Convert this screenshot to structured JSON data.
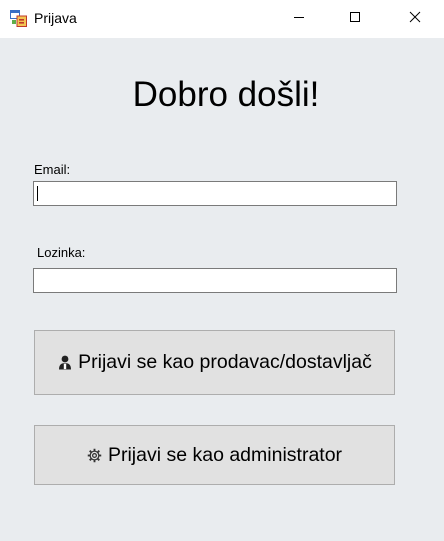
{
  "window": {
    "title": "Prijava",
    "app_icon": "form-icon",
    "controls": [
      "minimize-icon",
      "maximize-icon",
      "close-icon"
    ]
  },
  "form": {
    "heading": "Dobro došli!",
    "email_label": "Email:",
    "email_value": "",
    "password_label": "Lozinka:",
    "password_value": ""
  },
  "buttons": {
    "seller_label": "Prijavi se kao prodavac/dostavljač",
    "seller_icon": "user-icon",
    "admin_label": "Prijavi se kao administrator",
    "admin_icon": "gear-icon"
  },
  "colors": {
    "window_bg": "#e9ecef",
    "titlebar_bg": "#ffffff",
    "button_bg": "#e1e1e1",
    "button_border": "#adadad",
    "field_border": "#7a7a7a"
  }
}
